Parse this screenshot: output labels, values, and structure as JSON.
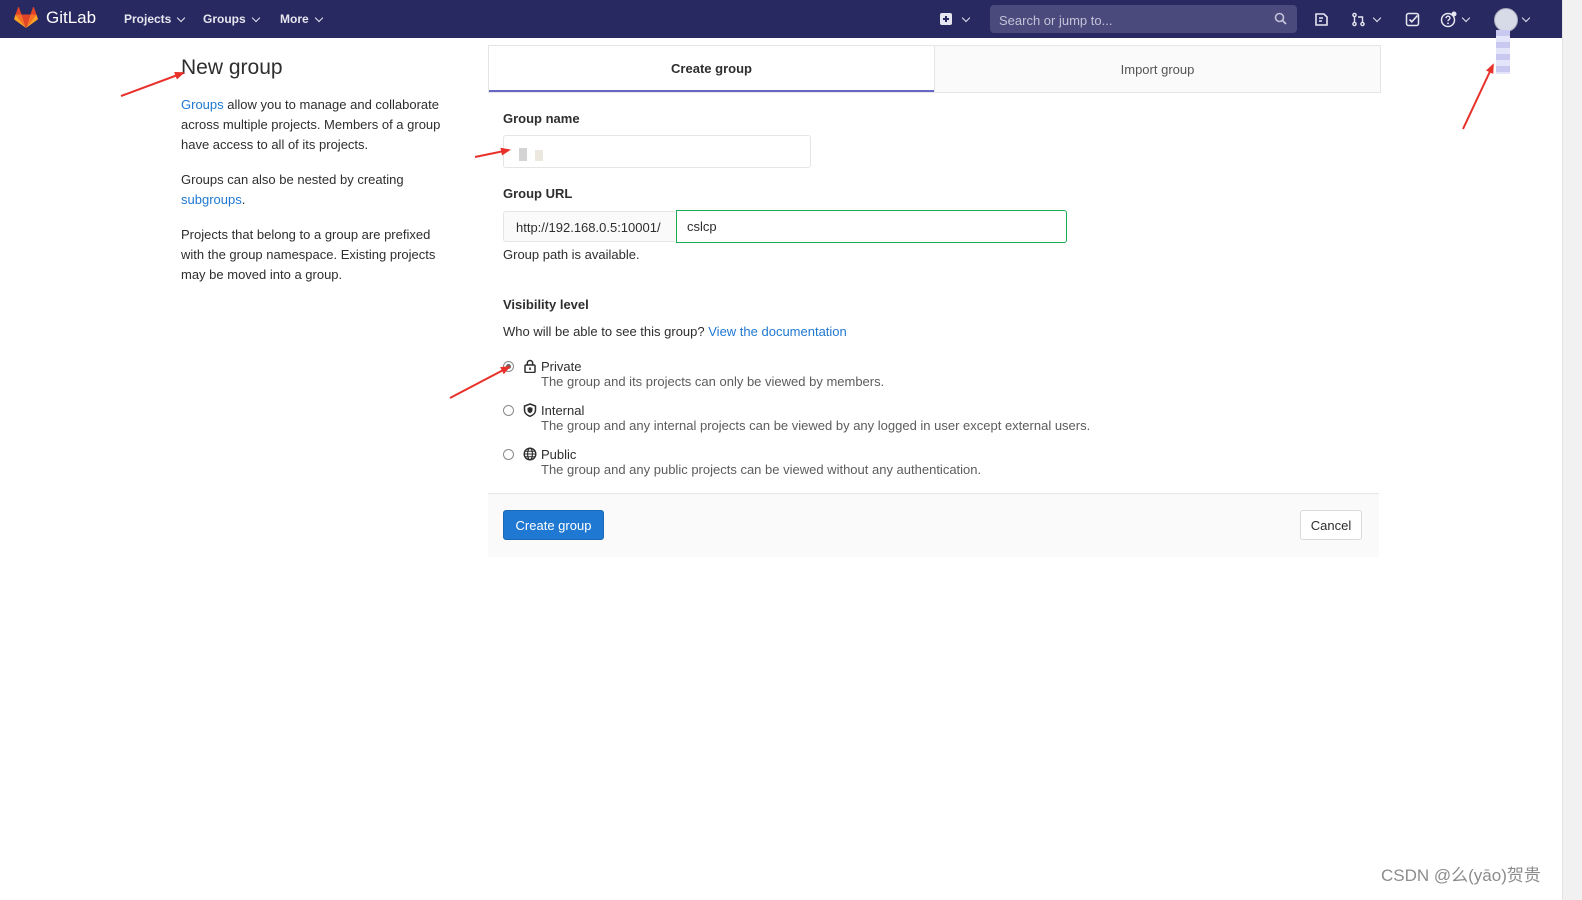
{
  "navbar": {
    "brand": "GitLab",
    "menus": [
      {
        "label": "Projects"
      },
      {
        "label": "Groups"
      },
      {
        "label": "More"
      }
    ],
    "search_placeholder": "Search or jump to...",
    "icons": [
      "plus-square-icon",
      "issues-icon",
      "merge-request-icon",
      "todo-check-icon",
      "help-icon",
      "avatar"
    ]
  },
  "sidebar": {
    "title": "New group",
    "p1_link": "Groups",
    "p1_text": " allow you to manage and collaborate across multiple projects. Members of a group have access to all of its projects.",
    "p2_text": "Groups can also be nested by creating ",
    "p2_link": "subgroups",
    "p2_end": ".",
    "p3_text": "Projects that belong to a group are prefixed with the group namespace. Existing projects may be moved into a group."
  },
  "tabs": {
    "create": "Create group",
    "import": "Import group"
  },
  "form": {
    "group_name_label": "Group name",
    "group_url_label": "Group URL",
    "url_prefix": "http://192.168.0.5:10001/",
    "url_value": "cslcp",
    "url_hint": "Group path is available.",
    "visibility_label": "Visibility level",
    "visibility_question": "Who will be able to see this group?",
    "visibility_doc_link": "View the documentation",
    "options": [
      {
        "title": "Private",
        "desc": "The group and its projects can only be viewed by members.",
        "checked": true,
        "icon": "lock-icon"
      },
      {
        "title": "Internal",
        "desc": "The group and any internal projects can be viewed by any logged in user except external users.",
        "checked": false,
        "icon": "shield-icon"
      },
      {
        "title": "Public",
        "desc": "The group and any public projects can be viewed without any authentication.",
        "checked": false,
        "icon": "globe-icon"
      }
    ]
  },
  "actions": {
    "create": "Create group",
    "cancel": "Cancel"
  },
  "watermark": "CSDN @么(yāo)贺贵",
  "colors": {
    "navbar": "#292961",
    "link": "#1f78d1",
    "primary_button": "#1f78d1",
    "valid_border": "#1aaa55",
    "tab_active_underline": "#6666c4",
    "annotation_arrow": "#e8312a"
  }
}
